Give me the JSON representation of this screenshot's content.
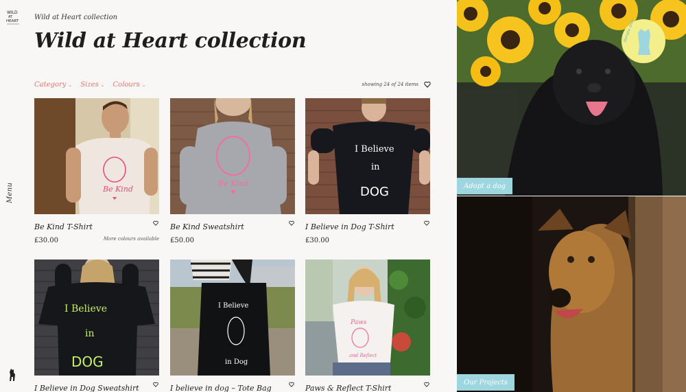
{
  "nav": {
    "menu_label": "Menu"
  },
  "breadcrumb": "Wild at Heart collection",
  "title": "Wild at Heart collection",
  "filters": [
    "Category",
    "Sizes",
    "Colours"
  ],
  "result_count": "showing 24 of 24 items",
  "products": [
    {
      "name": "Be Kind T-Shirt",
      "price": "£30.00",
      "note": "More colours available"
    },
    {
      "name": "Be Kind Sweatshirt",
      "price": "£50.00"
    },
    {
      "name": "I Believe in Dog T-Shirt",
      "price": "£30.00"
    },
    {
      "name": "I Believe in Dog Sweatshirt"
    },
    {
      "name": "I believe in dog – Tote Bag"
    },
    {
      "name": "Paws & Reflect T-Shirt"
    }
  ],
  "print_texts": {
    "be_kind": "Be Kind",
    "believe_line1": "I Believe",
    "believe_line2": "in",
    "believe_line3": "DOG",
    "tote_line1": "I Believe",
    "tote_line2": "in Dog",
    "paws_line1": "Paws",
    "paws_line2": "and Reflect"
  },
  "side_panels": [
    {
      "label": "Adopt a dog"
    },
    {
      "label": "Our Projects"
    }
  ],
  "badge_text": "donate donate",
  "colors": {
    "accent": "#e8736b",
    "label_bg": "#9dd6de",
    "badge": "#f3ef8a"
  }
}
